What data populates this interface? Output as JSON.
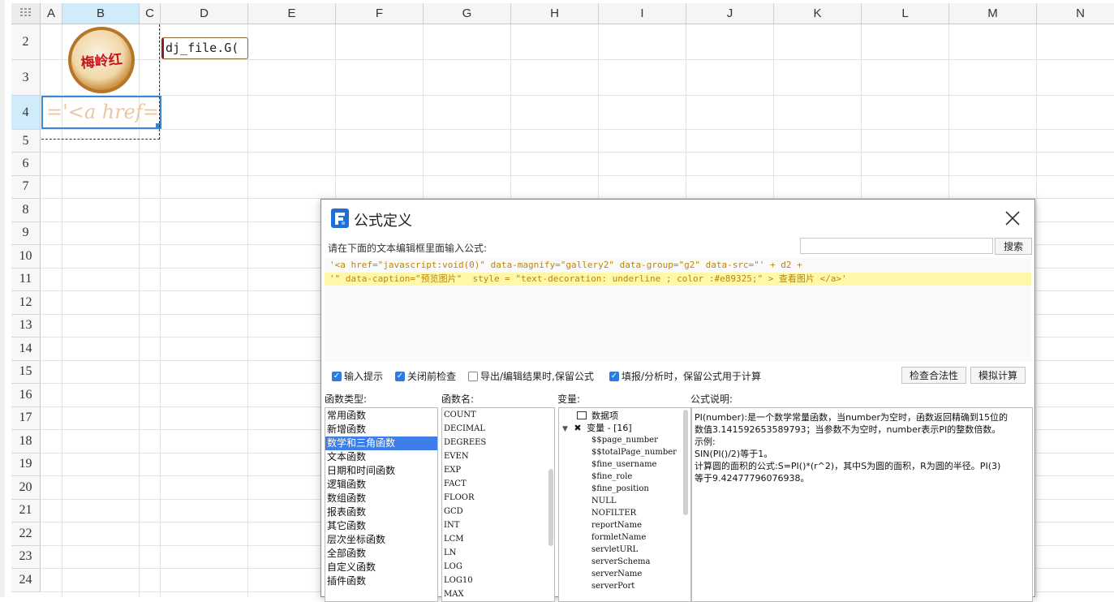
{
  "sheet": {
    "columns": [
      "A",
      "B",
      "C",
      "D",
      "E",
      "F",
      "G",
      "H",
      "I",
      "J",
      "K",
      "L",
      "M",
      "N"
    ],
    "rows": [
      "2",
      "3",
      "4",
      "5",
      "6",
      "7",
      "8",
      "9",
      "10",
      "11",
      "12",
      "13",
      "14",
      "15",
      "16",
      "17",
      "18",
      "19",
      "20",
      "21",
      "22",
      "23",
      "24"
    ],
    "selected_column": "B",
    "selected_row": "4",
    "cell_d2": "dj_file.G(",
    "cell_b4": "='<a href='",
    "logo_text": "梅岭红",
    "grid_icon": "grid-icon"
  },
  "dialog": {
    "title": "公式定义",
    "hint": "请在下面的文本编辑框里面输入公式:",
    "search_value": "",
    "search_button": "搜索",
    "code_line1": "'<a href=\"javascript:void(0)\" data-magnify=\"gallery2\" data-group=\"g2\" data-src=\"' + d2 +",
    "code_line2": "'\" data-caption=\"预览图片\"  style = \"text-decoration: underline ; color :#e89325;\" > 查看图片 </a>'",
    "options": [
      {
        "label": "输入提示",
        "checked": true
      },
      {
        "label": "关闭前检查",
        "checked": true
      },
      {
        "label": "导出/编辑结果时,保留公式",
        "checked": false
      },
      {
        "label": "填报/分析时，保留公式用于计算",
        "checked": true
      }
    ],
    "check_button": "检查合法性",
    "simulate_button": "模拟计算",
    "func_type_label": "函数类型:",
    "func_name_label": "函数名:",
    "var_label": "变量:",
    "desc_label": "公式说明:",
    "func_types": [
      "常用函数",
      "新增函数",
      "数学和三角函数",
      "文本函数",
      "日期和时间函数",
      "逻辑函数",
      "数组函数",
      "报表函数",
      "其它函数",
      "层次坐标函数",
      "全部函数",
      "自定义函数",
      "插件函数"
    ],
    "selected_func_type": "数学和三角函数",
    "func_names": [
      "COUNT",
      "DECIMAL",
      "DEGREES",
      "EVEN",
      "EXP",
      "FACT",
      "FLOOR",
      "GCD",
      "INT",
      "LCM",
      "LN",
      "LOG",
      "LOG10",
      "MAX"
    ],
    "var_tree": {
      "data_item": "数据项",
      "var_group": "变量 - [16]",
      "vars": [
        "$$page_number",
        "$$totalPage_number",
        "$fine_username",
        "$fine_role",
        "$fine_position",
        "NULL",
        "NOFILTER",
        "reportName",
        "formletName",
        "servletURL",
        "serverSchema",
        "serverName",
        "serverPort"
      ]
    },
    "description": [
      "PI(number):是一个数学常量函数，当number为空时，函数返回精确到15位的",
      "数值3.141592653589793；当参数不为空时，number表示PI的整数倍数。",
      "示例:",
      "SIN(PI()/2)等于1。",
      "计算圆的面积的公式:S=PI()*(r^2)，其中S为圆的面积，R为圆的半径。PI(3)",
      "等于9.42477796076938。"
    ]
  }
}
